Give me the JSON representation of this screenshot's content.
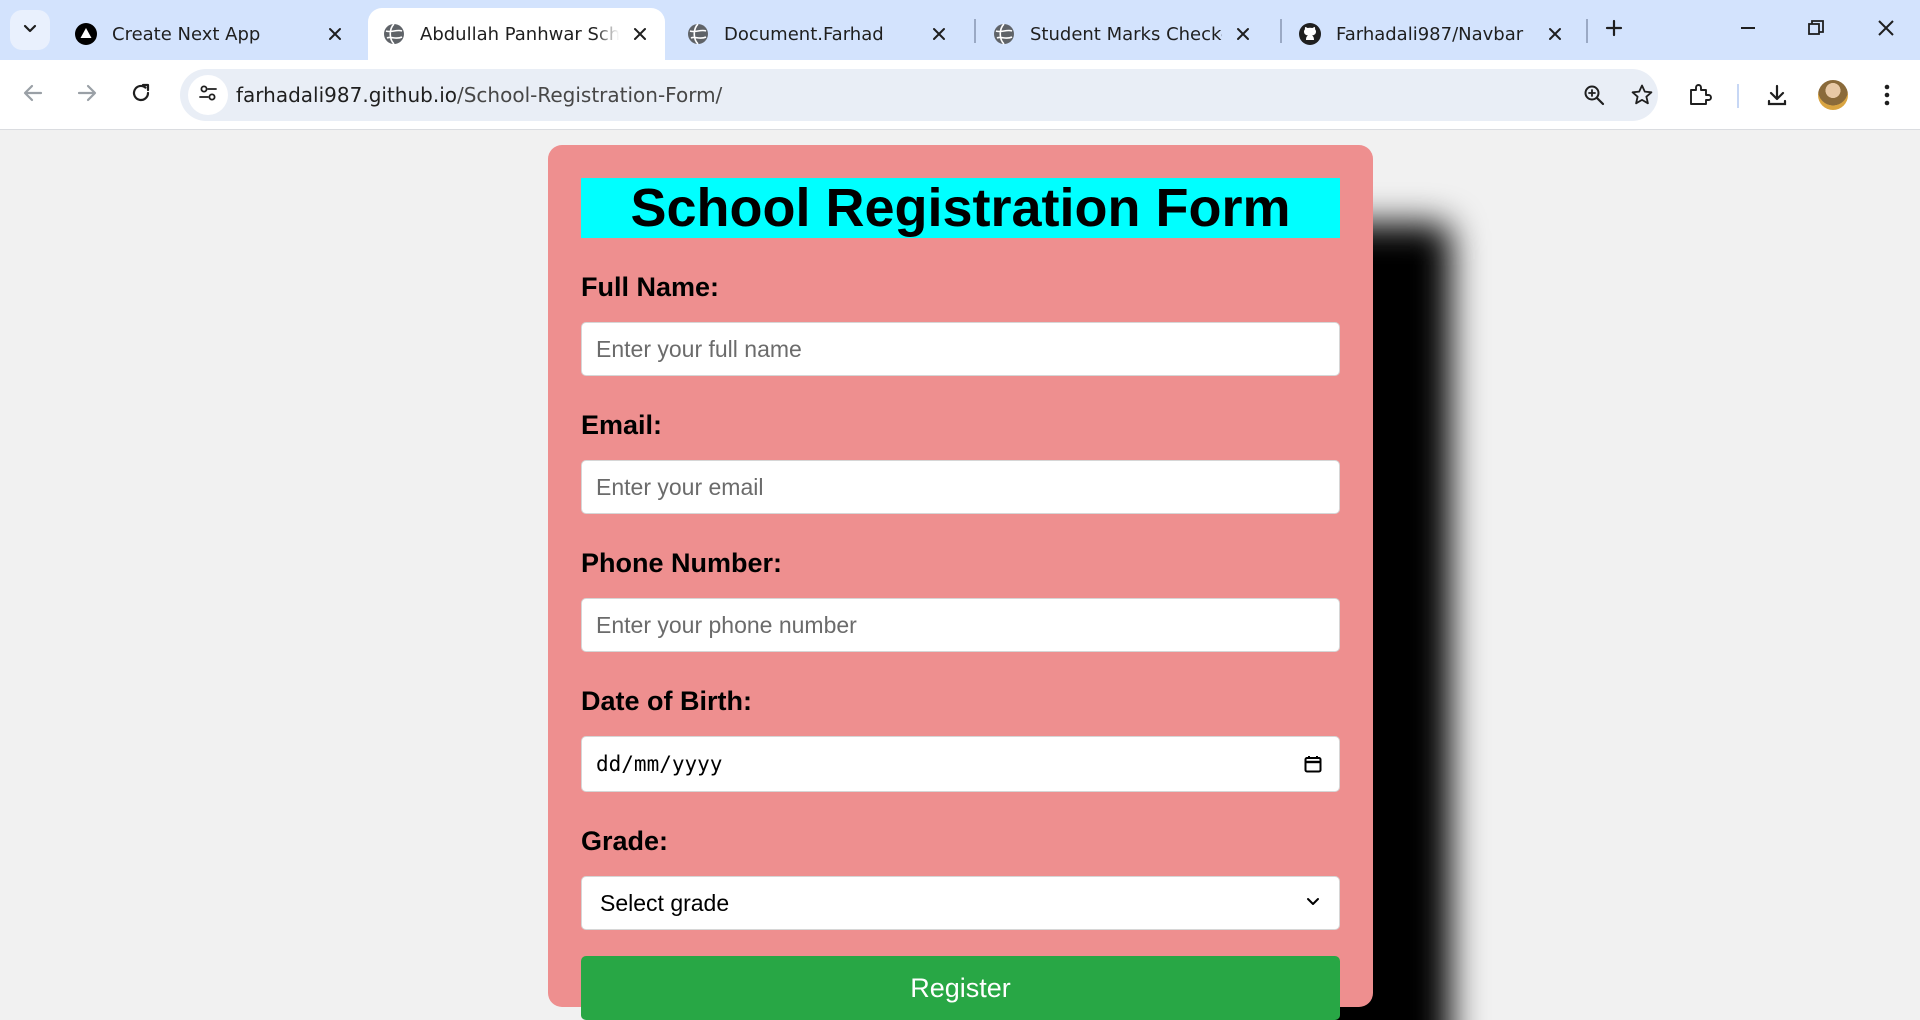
{
  "browser": {
    "tabs": [
      {
        "title": "Create Next App",
        "favicon": "nextjs-logo-icon",
        "active": false
      },
      {
        "title": "Abdullah Panhwar School",
        "favicon": "globe-icon",
        "active": true
      },
      {
        "title": "Document.Farhad",
        "favicon": "globe-icon",
        "active": false
      },
      {
        "title": "Student Marks Checker",
        "favicon": "globe-icon",
        "active": false
      },
      {
        "title": "Farhadali987/Navbar",
        "favicon": "github-icon",
        "active": false
      }
    ],
    "url_domain": "farhadali987.github.io",
    "url_path": "/School-Registration-Form/",
    "colors": {
      "tabstrip": "#d3e3fd",
      "omnibox": "#e9eef6"
    }
  },
  "form": {
    "title": "School Registration Form",
    "fields": {
      "full_name": {
        "label": "Full Name:",
        "placeholder": "Enter your full name",
        "value": ""
      },
      "email": {
        "label": "Email:",
        "placeholder": "Enter your email",
        "value": ""
      },
      "phone": {
        "label": "Phone Number:",
        "placeholder": "Enter your phone number",
        "value": ""
      },
      "dob": {
        "label": "Date of Birth:",
        "value": "dd/mm/yyyy"
      },
      "grade": {
        "label": "Grade:",
        "selected": "Select grade"
      }
    },
    "submit_label": "Register",
    "colors": {
      "card": "#ee8f8f",
      "title_bg": "#00ffff",
      "button": "#28a745",
      "page_bg": "#f1f1f1"
    }
  }
}
